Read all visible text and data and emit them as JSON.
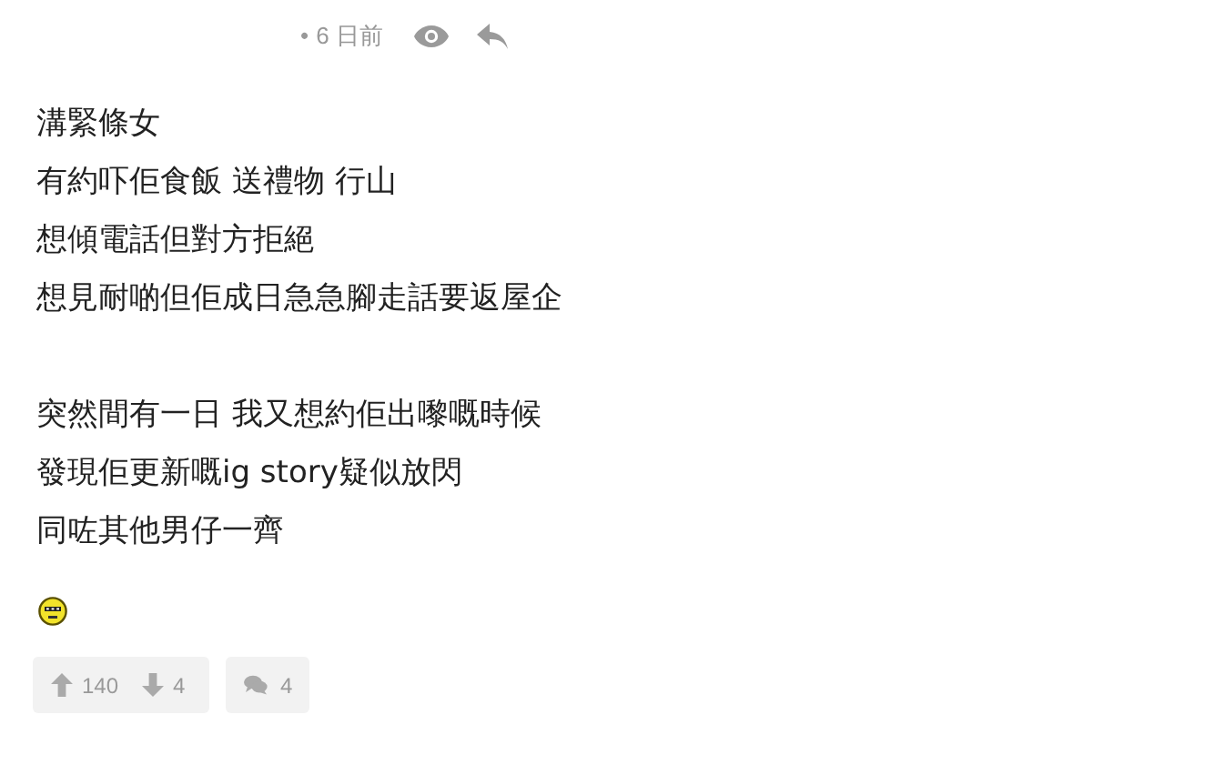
{
  "meta": {
    "bullet": "•",
    "time": "6 日前"
  },
  "paragraphs": [
    [
      "溝緊條女",
      "有約吓佢食飯 送禮物 行山",
      "想傾電話但對方拒絕",
      "想見耐啲但佢成日急急腳走話要返屋企"
    ],
    [
      "突然間有一日 我又想約佢出嚟嘅時候",
      "發現佢更新嘅ig story疑似放閃",
      "同咗其他男仔一齊"
    ]
  ],
  "votes": {
    "up": "140",
    "down": "4"
  },
  "replies": {
    "count": "4"
  }
}
